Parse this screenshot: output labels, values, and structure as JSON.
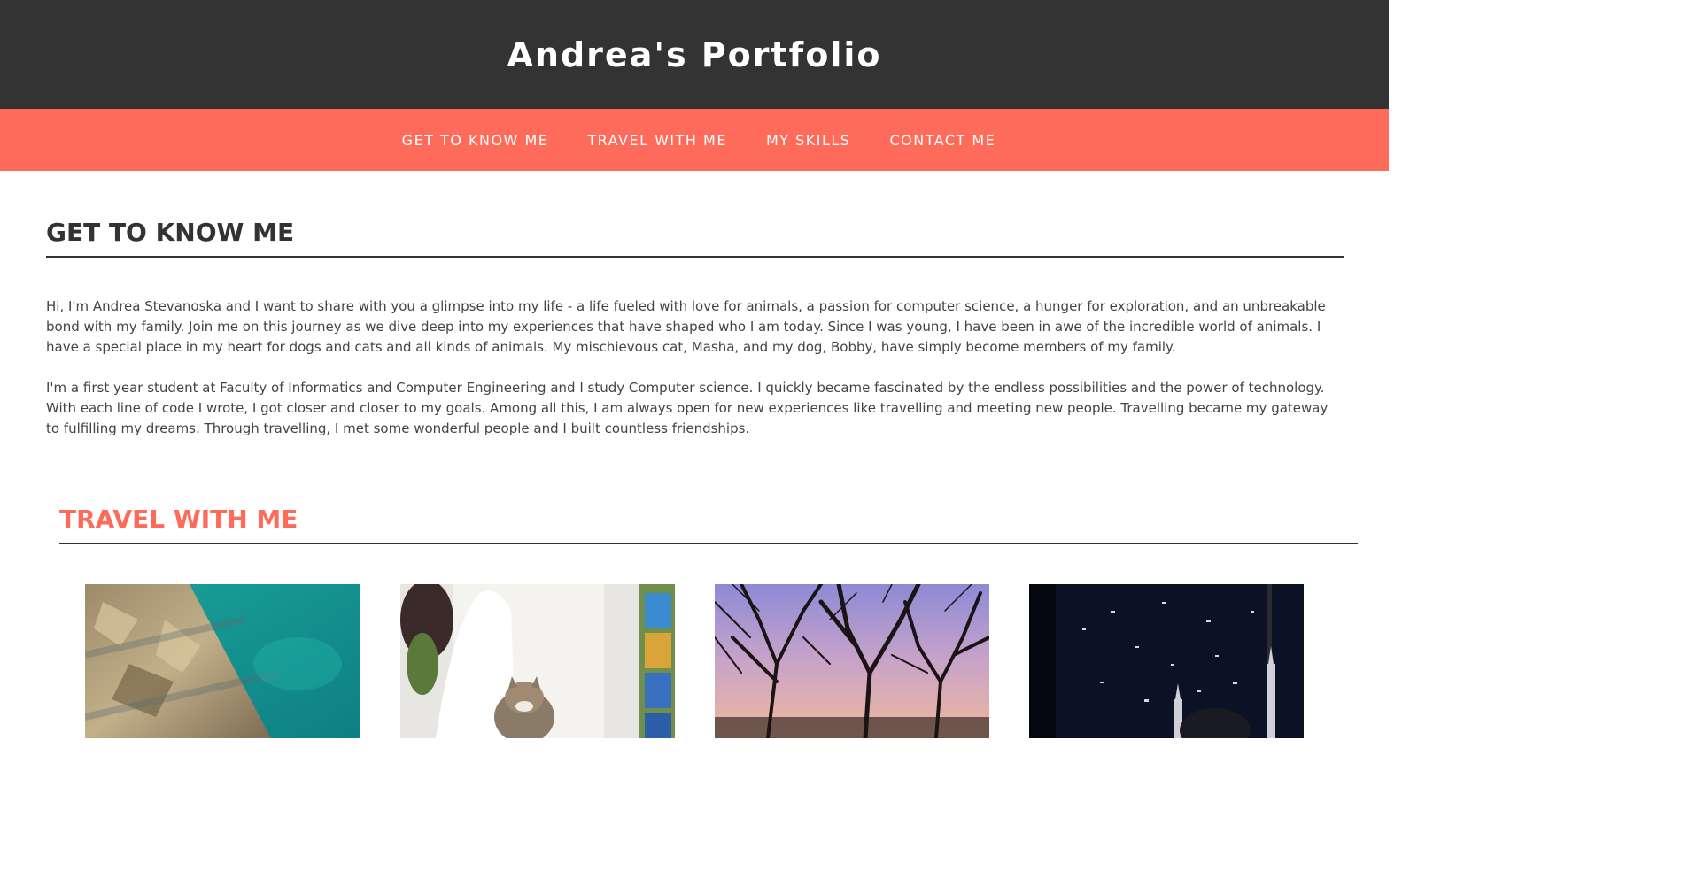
{
  "header": {
    "title": "Andrea's Portfolio"
  },
  "nav": {
    "items": [
      {
        "label": "GET TO KNOW ME"
      },
      {
        "label": "TRAVEL WITH ME"
      },
      {
        "label": "MY SKILLS"
      },
      {
        "label": "CONTACT ME"
      }
    ]
  },
  "about": {
    "heading": "GET TO KNOW ME",
    "paragraphs": [
      "Hi, I'm Andrea Stevanoska and I want to share with you a glimpse into my life - a life fueled with love for animals, a passion for computer science, a hunger for exploration, and an unbreakable bond with my family. Join me on this journey as we dive deep into my experiences that have shaped who I am today. Since I was young, I have been in awe of the incredible world of animals. I have a special place in my heart for dogs and cats and all kinds of animals. My mischievous cat, Masha, and my dog, Bobby, have simply become members of my family.",
      "I'm a first year student at Faculty of Informatics and Computer Engineering and I study Computer science. I quickly became fascinated by the endless possibilities and the power of technology. With each line of code I wrote, I got closer and closer to my goals. Among all this, I am always open for new experiences like travelling and meeting new people. Travelling became my gateway to fulfilling my dreams. Through travelling, I met some wonderful people and I built countless friendships."
    ]
  },
  "travel": {
    "heading": "TRAVEL WITH ME",
    "photos": [
      {
        "name": "sea-rocks-photo"
      },
      {
        "name": "cat-photo"
      },
      {
        "name": "sunset-trees-photo"
      },
      {
        "name": "night-mosque-photo"
      }
    ]
  },
  "colors": {
    "header_bg": "#333333",
    "nav_bg": "#ff6b5b",
    "accent": "#ff6b5b",
    "text": "#333333"
  }
}
